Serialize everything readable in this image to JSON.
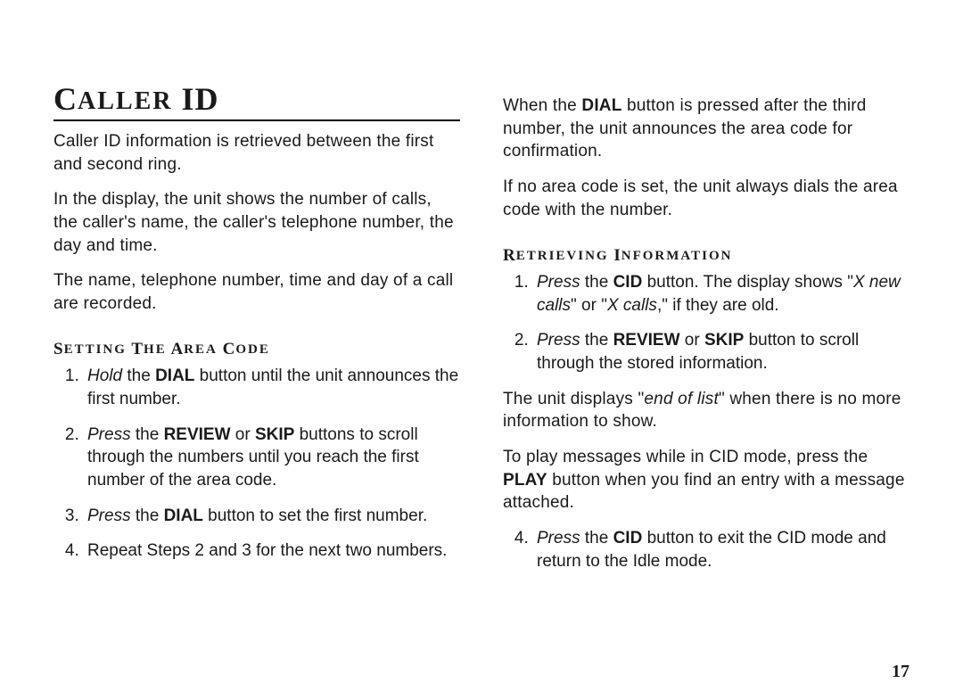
{
  "title_big1": "C",
  "title_sc1": "ALLER",
  "title_big2": " ID",
  "intro_p1": "Caller ID information is retrieved between the first and second ring.",
  "intro_p2": "In the display, the unit shows the number of calls, the caller's name, the caller's telephone number, the day and time.",
  "intro_p3": "The name, telephone number, time and day of a call are recorded.",
  "sub1_big1": "S",
  "sub1_sc1": "ETTING",
  "sub1_sp1": " ",
  "sub1_big2": "T",
  "sub1_sc2": "HE",
  "sub1_sp2": " ",
  "sub1_big3": "A",
  "sub1_sc3": "REA",
  "sub1_sp3": " ",
  "sub1_big4": "C",
  "sub1_sc4": "ODE",
  "s1_li1_a": "Hold",
  "s1_li1_b": " the ",
  "s1_li1_c": "DIAL",
  "s1_li1_d": " button until the unit announces the first number.",
  "s1_li2_a": "Press",
  "s1_li2_b": " the ",
  "s1_li2_c": "REVIEW",
  "s1_li2_d": " or ",
  "s1_li2_e": "SKIP",
  "s1_li2_f": " buttons to scroll through the numbers until you reach the first number of the area code.",
  "s1_li3_a": "Press",
  "s1_li3_b": " the ",
  "s1_li3_c": "DIAL",
  "s1_li3_d": " button to set the first number.",
  "s1_li4": "Repeat Steps 2 and 3 for the next two numbers.",
  "col2_p1_a": "When the ",
  "col2_p1_b": "DIAL",
  "col2_p1_c": " button is pressed after the third number, the unit announces the area code for confirmation.",
  "col2_p2": "If no area code is set, the unit always dials the area code with the number.",
  "sub2_big1": "R",
  "sub2_sc1": "ETRIEVING",
  "sub2_sp1": " ",
  "sub2_big2": "I",
  "sub2_sc2": "NFORMATION",
  "s2_li1_a": "Press",
  "s2_li1_b": " the ",
  "s2_li1_c": "CID",
  "s2_li1_d": " button. The display shows \"",
  "s2_li1_e": "X new calls",
  "s2_li1_f": "\" or \"",
  "s2_li1_g": "X calls",
  "s2_li1_h": ",\" if they are old.",
  "s2_li2_a": "Press",
  "s2_li2_b": " the ",
  "s2_li2_c": "REVIEW",
  "s2_li2_d": " or ",
  "s2_li2_e": "SKIP",
  "s2_li2_f": " button to scroll through the stored information.",
  "col2_p3_a": "The unit displays \"",
  "col2_p3_b": "end of list",
  "col2_p3_c": "\" when there is no more information to show.",
  "col2_p4_a": "To play messages while in CID mode, press the ",
  "col2_p4_b": "PLAY",
  "col2_p4_c": " button when you find an entry with a message attached.",
  "s2_li4_a": "Press",
  "s2_li4_b": " the ",
  "s2_li4_c": "CID",
  "s2_li4_d": " button to exit the CID mode and return to the Idle mode.",
  "page_number": "17"
}
